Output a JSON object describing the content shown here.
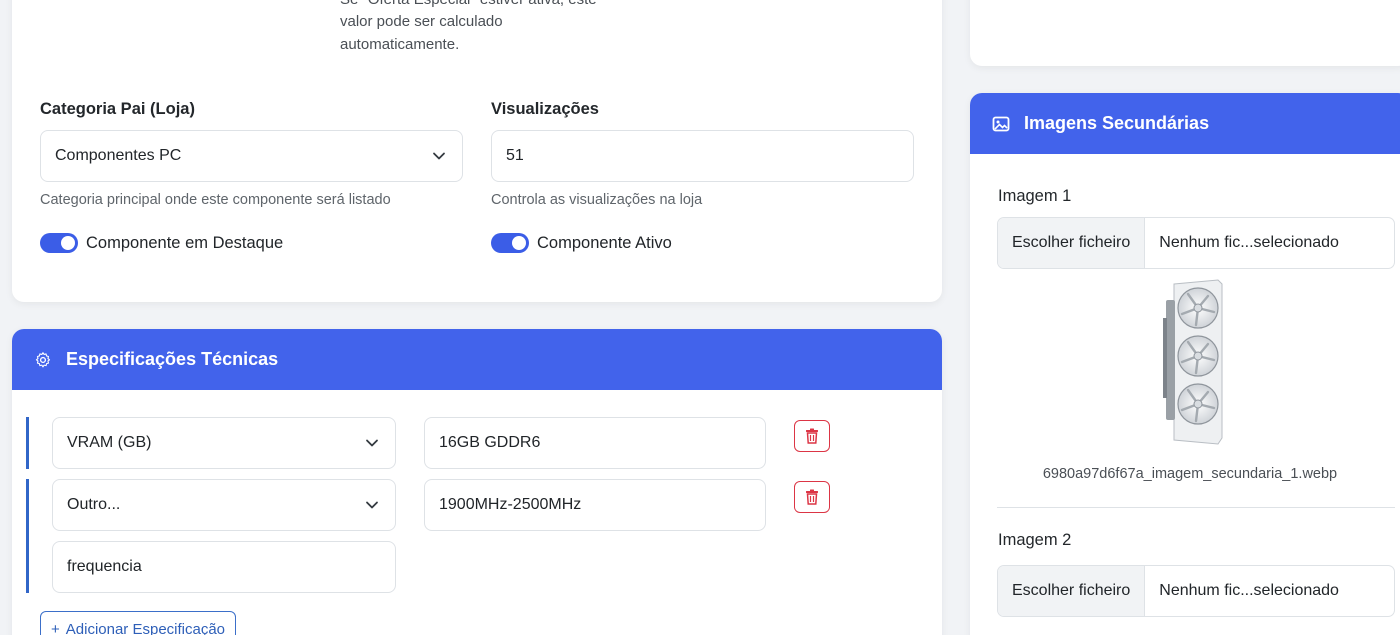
{
  "general": {
    "offer_hint_line1": "Se \"Oferta Especial\" estiver ativa, este",
    "offer_hint_line2": "valor pode ser calculado",
    "offer_hint_line3": "automaticamente.",
    "category_label": "Categoria Pai (Loja)",
    "category_value": "Componentes PC",
    "category_hint": "Categoria principal onde este componente será listado",
    "views_label": "Visualizações",
    "views_value": "51",
    "views_hint": "Controla as visualizações na loja",
    "featured_toggle_label": "Componente em Destaque",
    "featured_on": true,
    "active_toggle_label": "Componente Ativo",
    "active_on": true
  },
  "specs": {
    "title": "Especificações Técnicas",
    "rows": [
      {
        "type": "VRAM (GB)",
        "value": "16GB GDDR6"
      },
      {
        "type": "Outro...",
        "value": "1900MHz-2500MHz",
        "custom_name": "frequencia"
      }
    ],
    "add_label": "Adicionar Especificação",
    "add_plus": "+"
  },
  "images": {
    "title": "Imagens Secundárias",
    "items": [
      {
        "label": "Imagem 1",
        "choose_label": "Escolher ficheiro",
        "file_status": "Nenhum fic...selecionado",
        "filename": "6980a97d6f67a_imagem_secundaria_1.webp"
      },
      {
        "label": "Imagem 2",
        "choose_label": "Escolher ficheiro",
        "file_status": "Nenhum fic...selecionado"
      }
    ]
  },
  "colors": {
    "accent": "#4263eb",
    "danger": "#dc3545",
    "border": "#dee2e6",
    "background": "#f1f3f6"
  },
  "icons": [
    "chevron-down-icon",
    "gear-icon",
    "image-icon",
    "trash-icon"
  ]
}
